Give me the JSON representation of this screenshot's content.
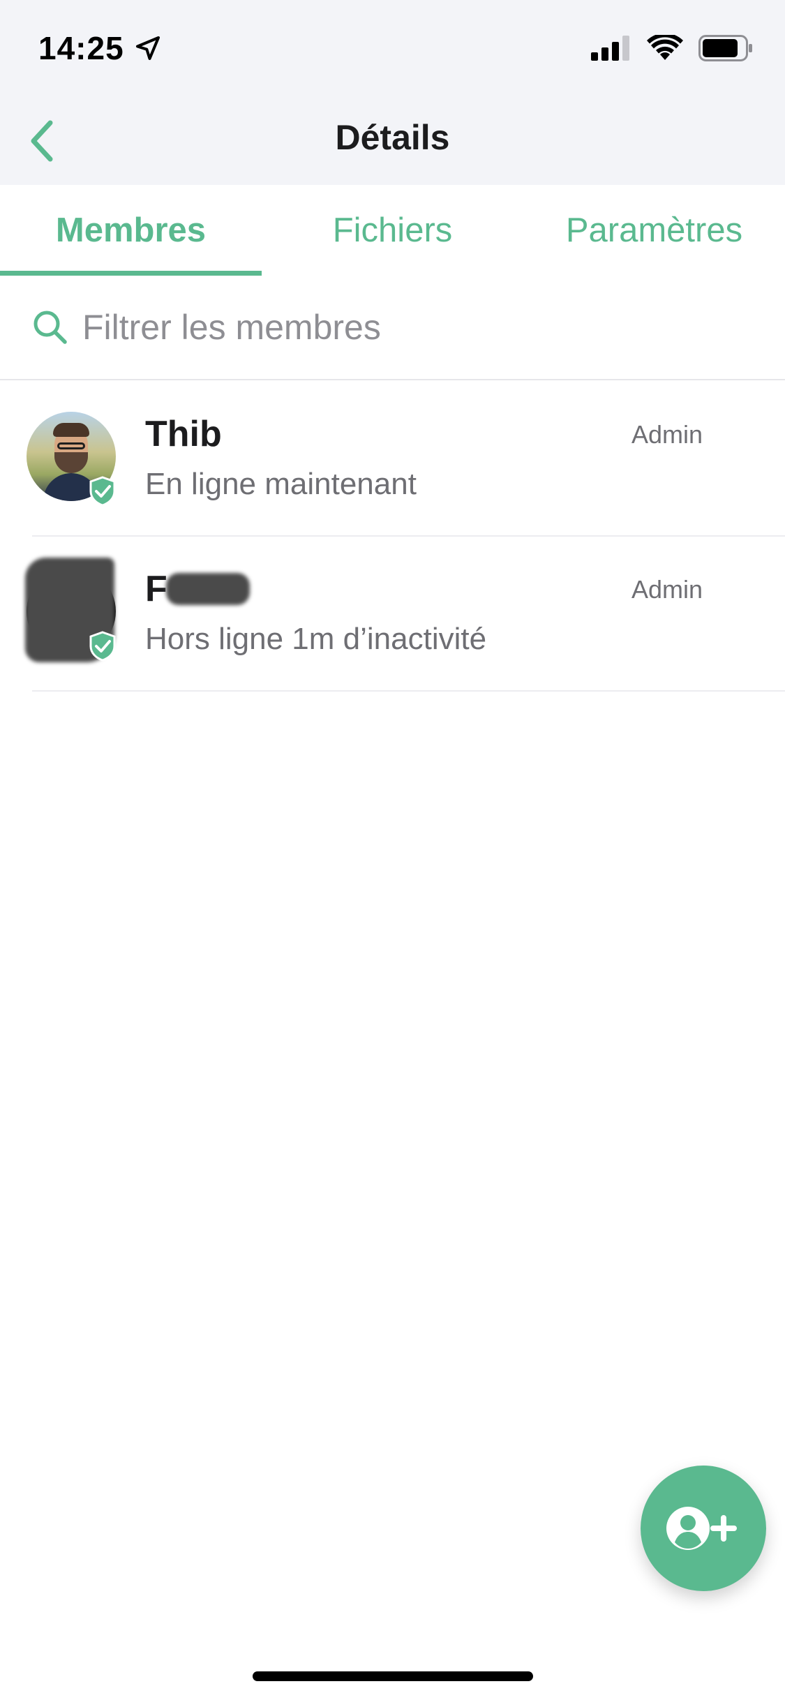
{
  "status_bar": {
    "time": "14:25",
    "location_icon": "location-arrow-icon",
    "signal_icon": "cellular-signal-icon",
    "wifi_icon": "wifi-icon",
    "battery_icon": "battery-icon"
  },
  "navbar": {
    "title": "Détails",
    "back_icon": "chevron-left-icon"
  },
  "tabs": [
    {
      "label": "Membres",
      "active": true
    },
    {
      "label": "Fichiers",
      "active": false
    },
    {
      "label": "Paramètres",
      "active": false
    }
  ],
  "search": {
    "placeholder": "Filtrer les membres",
    "value": "",
    "icon": "search-icon"
  },
  "members": [
    {
      "name": "Thib",
      "status": "En ligne maintenant",
      "role": "Admin",
      "verified": true
    },
    {
      "name": "F",
      "status": "Hors ligne 1m d’inactivité",
      "role": "Admin",
      "verified": true
    }
  ],
  "fab": {
    "icon": "add-user-icon"
  },
  "colors": {
    "accent": "#5ab98f",
    "header_bg": "#f3f4f8",
    "secondary_text": "#6e6e73"
  }
}
